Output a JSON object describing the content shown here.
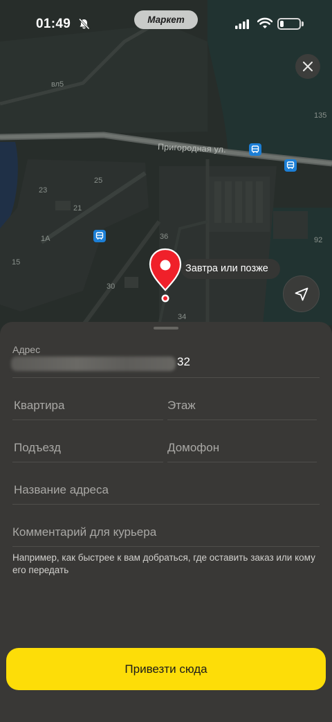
{
  "status_bar": {
    "time": "01:49",
    "app_pill": "Маркет",
    "battery_level": 0.2
  },
  "map": {
    "street_name": "Пригородная ул.",
    "house_numbers": [
      "вл5",
      "135",
      "25",
      "23",
      "21",
      "1А",
      "36",
      "92",
      "15",
      "30",
      "34"
    ],
    "pin_tooltip": "Завтра или позже",
    "colors": {
      "pin": "#f0202a",
      "bus_stop": "#1c7fd6"
    }
  },
  "sheet": {
    "address_label": "Адрес",
    "address_house": "32",
    "fields": {
      "apartment": "Квартира",
      "floor": "Этаж",
      "entrance": "Подъезд",
      "intercom": "Домофон",
      "address_name": "Название адреса",
      "courier_comment": "Комментарий для курьера"
    },
    "hint": "Например, как быстрее к вам добраться, где оставить заказ или кому его передать",
    "submit_label": "Привезти сюда",
    "colors": {
      "accent": "#fddd08"
    }
  }
}
